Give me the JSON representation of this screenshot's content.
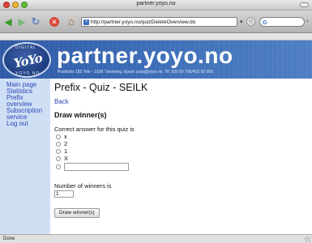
{
  "window": {
    "title": "partner.yoyo.no"
  },
  "toolbar": {
    "url": "http://partner.yoyo.no/quizDeleteOverview.do",
    "search_value": ""
  },
  "icons": {
    "back": "back-arrow-icon",
    "forward": "forward-arrow-icon",
    "reload": "reload-icon",
    "stop": "stop-icon",
    "home": "home-icon",
    "site": "site-favicon",
    "search_engine": "google-icon"
  },
  "banner": {
    "brand": "partner.yoyo.no",
    "address_line": "Postboks 182 Tele - 3106 Tønsberg. Epost: post@yoyo.no. Tlf. 920 50 766/415 60 905",
    "logo_text": "YoYo",
    "logo_ring_top": "DIGITAL",
    "logo_ring_bottom": "YOYO NO"
  },
  "sidebar": {
    "items": [
      {
        "label": "Main page"
      },
      {
        "label": "Statistics"
      },
      {
        "label": "Prefix overview"
      },
      {
        "label": "Subscription service"
      },
      {
        "label": "Log out"
      }
    ]
  },
  "main": {
    "title": "Prefix - Quiz - SEILK",
    "back_label": "Back",
    "section_title": "Draw winner(s)",
    "question_label": "Correct answer for this quiz is",
    "options": [
      {
        "label": "x"
      },
      {
        "label": "2"
      },
      {
        "label": "1"
      },
      {
        "label": "X"
      }
    ],
    "other_value": "",
    "winners_label": "Number of winners is",
    "winners_value": "1",
    "draw_button_label": "Draw winner(s)"
  },
  "status": {
    "text": "Done"
  },
  "colors": {
    "link": "#2b46b8",
    "sidebar_bg": "#cfe0f5",
    "banner_bg": "#3b6bb5"
  }
}
